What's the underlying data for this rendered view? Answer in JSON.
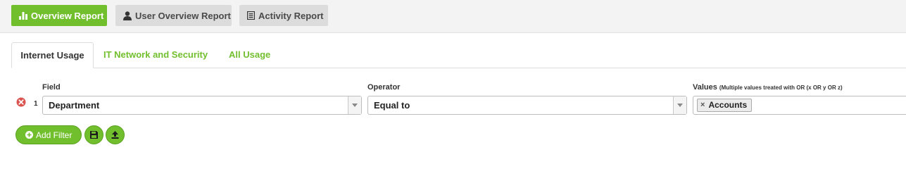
{
  "report_buttons": {
    "overview": "Overview Report",
    "user_overview": "User Overview Report",
    "activity": "Activity Report"
  },
  "tabs": [
    "Internet Usage",
    "IT Network and Security",
    "All Usage"
  ],
  "filter": {
    "field_label": "Field",
    "operator_label": "Operator",
    "values_label": "Values",
    "values_hint": "(Multiple values treated with OR (x OR y OR z)",
    "row_number": "1",
    "field_value": "Department",
    "operator_value": "Equal to",
    "values": [
      "Accounts"
    ],
    "chip_remove": "×"
  },
  "actions": {
    "add_filter": "Add Filter"
  },
  "icons": [
    "bar-chart-icon",
    "user-icon",
    "list-icon",
    "remove-circle-icon",
    "plus-circle-icon",
    "save-icon",
    "upload-icon"
  ],
  "colors": {
    "accent": "#72bf2e",
    "danger": "#d9534f",
    "button_gray": "#dcdcdc"
  }
}
